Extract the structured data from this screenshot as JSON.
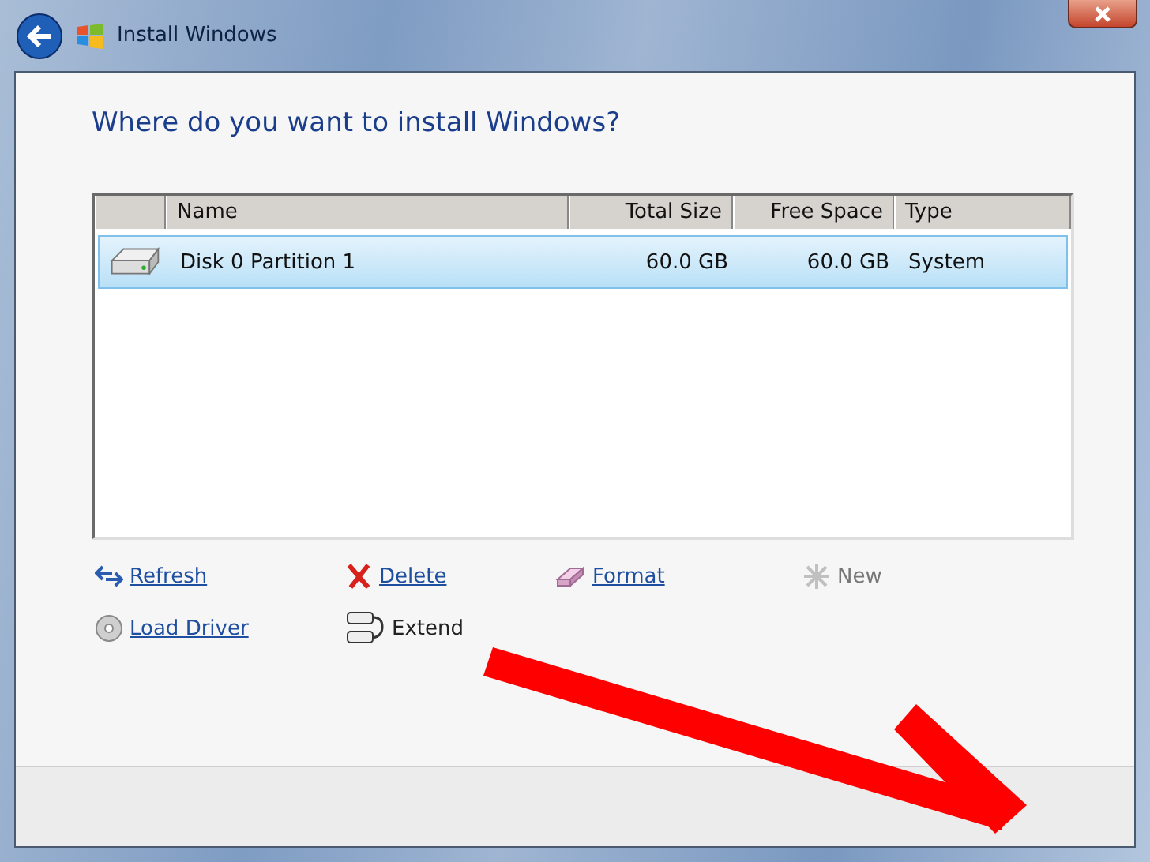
{
  "window": {
    "title": "Install Windows"
  },
  "heading": "Where do you want to install Windows?",
  "table": {
    "columns": [
      "Name",
      "Total Size",
      "Free Space",
      "Type"
    ],
    "rows": [
      {
        "name": "Disk 0 Partition 1",
        "total_size": "60.0 GB",
        "free_space": "60.0 GB",
        "type": "System",
        "selected": true
      }
    ]
  },
  "actions": [
    {
      "label": "Refresh",
      "kind": "link",
      "disabled": false
    },
    {
      "label": "Delete",
      "kind": "link",
      "disabled": false
    },
    {
      "label": "Format",
      "kind": "link",
      "disabled": false
    },
    {
      "label": "New",
      "kind": "link",
      "disabled": true
    },
    {
      "label": "Load Driver",
      "kind": "link",
      "disabled": false
    },
    {
      "label": "Extend",
      "kind": "plain",
      "disabled": false
    }
  ]
}
